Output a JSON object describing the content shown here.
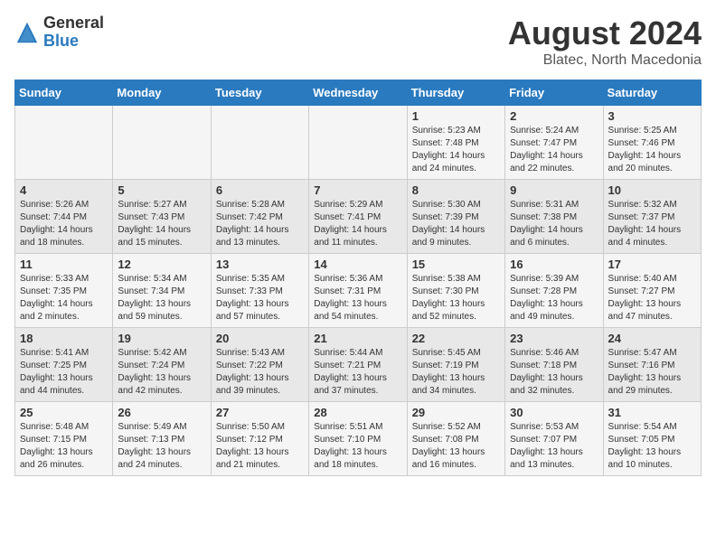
{
  "header": {
    "logo_general": "General",
    "logo_blue": "Blue",
    "title": "August 2024",
    "location": "Blatec, North Macedonia"
  },
  "weekdays": [
    "Sunday",
    "Monday",
    "Tuesday",
    "Wednesday",
    "Thursday",
    "Friday",
    "Saturday"
  ],
  "weeks": [
    [
      {
        "day": "",
        "info": ""
      },
      {
        "day": "",
        "info": ""
      },
      {
        "day": "",
        "info": ""
      },
      {
        "day": "",
        "info": ""
      },
      {
        "day": "1",
        "info": "Sunrise: 5:23 AM\nSunset: 7:48 PM\nDaylight: 14 hours and 24 minutes."
      },
      {
        "day": "2",
        "info": "Sunrise: 5:24 AM\nSunset: 7:47 PM\nDaylight: 14 hours and 22 minutes."
      },
      {
        "day": "3",
        "info": "Sunrise: 5:25 AM\nSunset: 7:46 PM\nDaylight: 14 hours and 20 minutes."
      }
    ],
    [
      {
        "day": "4",
        "info": "Sunrise: 5:26 AM\nSunset: 7:44 PM\nDaylight: 14 hours and 18 minutes."
      },
      {
        "day": "5",
        "info": "Sunrise: 5:27 AM\nSunset: 7:43 PM\nDaylight: 14 hours and 15 minutes."
      },
      {
        "day": "6",
        "info": "Sunrise: 5:28 AM\nSunset: 7:42 PM\nDaylight: 14 hours and 13 minutes."
      },
      {
        "day": "7",
        "info": "Sunrise: 5:29 AM\nSunset: 7:41 PM\nDaylight: 14 hours and 11 minutes."
      },
      {
        "day": "8",
        "info": "Sunrise: 5:30 AM\nSunset: 7:39 PM\nDaylight: 14 hours and 9 minutes."
      },
      {
        "day": "9",
        "info": "Sunrise: 5:31 AM\nSunset: 7:38 PM\nDaylight: 14 hours and 6 minutes."
      },
      {
        "day": "10",
        "info": "Sunrise: 5:32 AM\nSunset: 7:37 PM\nDaylight: 14 hours and 4 minutes."
      }
    ],
    [
      {
        "day": "11",
        "info": "Sunrise: 5:33 AM\nSunset: 7:35 PM\nDaylight: 14 hours and 2 minutes."
      },
      {
        "day": "12",
        "info": "Sunrise: 5:34 AM\nSunset: 7:34 PM\nDaylight: 13 hours and 59 minutes."
      },
      {
        "day": "13",
        "info": "Sunrise: 5:35 AM\nSunset: 7:33 PM\nDaylight: 13 hours and 57 minutes."
      },
      {
        "day": "14",
        "info": "Sunrise: 5:36 AM\nSunset: 7:31 PM\nDaylight: 13 hours and 54 minutes."
      },
      {
        "day": "15",
        "info": "Sunrise: 5:38 AM\nSunset: 7:30 PM\nDaylight: 13 hours and 52 minutes."
      },
      {
        "day": "16",
        "info": "Sunrise: 5:39 AM\nSunset: 7:28 PM\nDaylight: 13 hours and 49 minutes."
      },
      {
        "day": "17",
        "info": "Sunrise: 5:40 AM\nSunset: 7:27 PM\nDaylight: 13 hours and 47 minutes."
      }
    ],
    [
      {
        "day": "18",
        "info": "Sunrise: 5:41 AM\nSunset: 7:25 PM\nDaylight: 13 hours and 44 minutes."
      },
      {
        "day": "19",
        "info": "Sunrise: 5:42 AM\nSunset: 7:24 PM\nDaylight: 13 hours and 42 minutes."
      },
      {
        "day": "20",
        "info": "Sunrise: 5:43 AM\nSunset: 7:22 PM\nDaylight: 13 hours and 39 minutes."
      },
      {
        "day": "21",
        "info": "Sunrise: 5:44 AM\nSunset: 7:21 PM\nDaylight: 13 hours and 37 minutes."
      },
      {
        "day": "22",
        "info": "Sunrise: 5:45 AM\nSunset: 7:19 PM\nDaylight: 13 hours and 34 minutes."
      },
      {
        "day": "23",
        "info": "Sunrise: 5:46 AM\nSunset: 7:18 PM\nDaylight: 13 hours and 32 minutes."
      },
      {
        "day": "24",
        "info": "Sunrise: 5:47 AM\nSunset: 7:16 PM\nDaylight: 13 hours and 29 minutes."
      }
    ],
    [
      {
        "day": "25",
        "info": "Sunrise: 5:48 AM\nSunset: 7:15 PM\nDaylight: 13 hours and 26 minutes."
      },
      {
        "day": "26",
        "info": "Sunrise: 5:49 AM\nSunset: 7:13 PM\nDaylight: 13 hours and 24 minutes."
      },
      {
        "day": "27",
        "info": "Sunrise: 5:50 AM\nSunset: 7:12 PM\nDaylight: 13 hours and 21 minutes."
      },
      {
        "day": "28",
        "info": "Sunrise: 5:51 AM\nSunset: 7:10 PM\nDaylight: 13 hours and 18 minutes."
      },
      {
        "day": "29",
        "info": "Sunrise: 5:52 AM\nSunset: 7:08 PM\nDaylight: 13 hours and 16 minutes."
      },
      {
        "day": "30",
        "info": "Sunrise: 5:53 AM\nSunset: 7:07 PM\nDaylight: 13 hours and 13 minutes."
      },
      {
        "day": "31",
        "info": "Sunrise: 5:54 AM\nSunset: 7:05 PM\nDaylight: 13 hours and 10 minutes."
      }
    ]
  ]
}
